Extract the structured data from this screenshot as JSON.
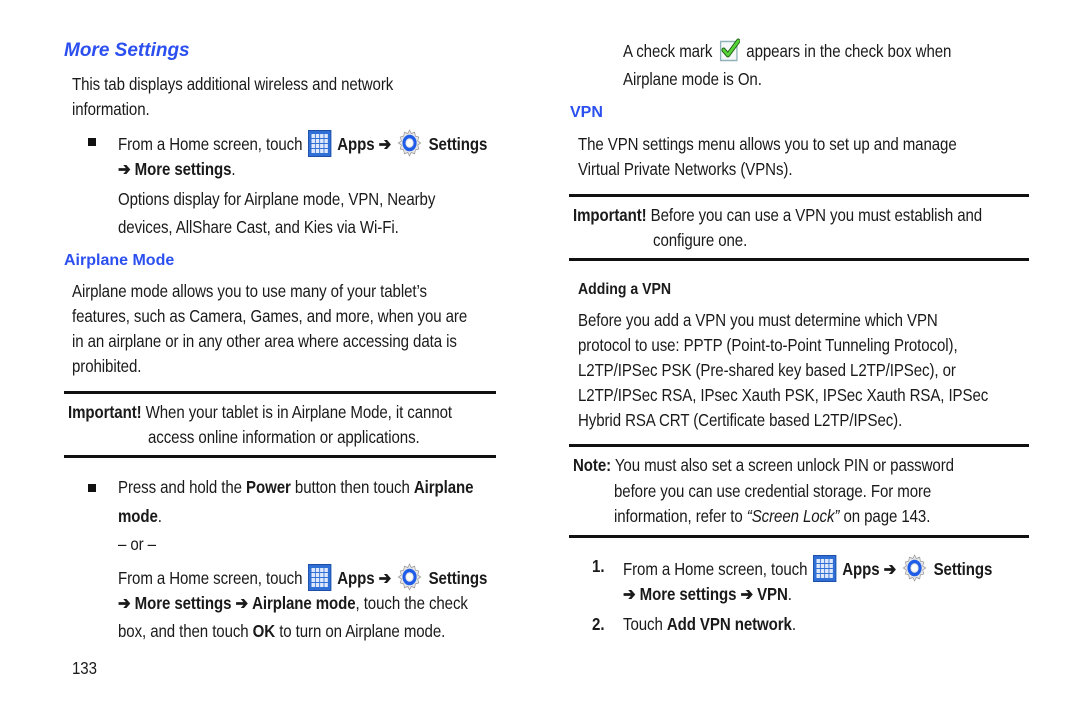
{
  "page_number": "133",
  "left": {
    "title": "More Settings",
    "intro": [
      "This tab displays additional wireless and network",
      "information."
    ],
    "step1": {
      "prefix": "From a Home screen, touch",
      "apps": "Apps",
      "arrow": "➔",
      "settings": "Settings",
      "line2_arrow": "➔",
      "line2_bold": "More settings",
      "line2_end": "."
    },
    "options_text": [
      "Options display for Airplane mode, VPN, Nearby",
      "devices, AllShare Cast, and Kies via Wi-Fi."
    ],
    "airplane_heading": "Airplane Mode",
    "airplane_body": [
      "Airplane mode allows you to use many of your tablet’s",
      "features, such as Camera, Games, and more, when you are",
      "in an airplane or in any other area where accessing data is",
      "prohibited."
    ],
    "important": {
      "label": "Important!",
      "line1": "When your tablet is in Airplane Mode, it cannot",
      "line2": "access online information or applications."
    },
    "step2": {
      "l1_a": "Press and hold the",
      "l1_b": "Power",
      "l1_c": "button then touch",
      "l1_d": "Airplane",
      "l2_bold": "mode",
      "l2_end": ".",
      "or": "– or –",
      "l3_prefix": "From a Home screen, touch",
      "l3_apps": "Apps",
      "l3_arrow": "➔",
      "l3_settings": "Settings",
      "l4_arrow1": "➔",
      "l4_more": "More settings",
      "l4_arrow2": "➔",
      "l4_airplane": "Airplane mode",
      "l4_end": ", touch the check",
      "l5_a": "box, and then touch",
      "l5_ok": "OK",
      "l5_end": "to turn on Airplane mode."
    }
  },
  "right": {
    "check_line1_a": "A check mark",
    "check_line1_b": "appears in the check box when",
    "check_line2": "Airplane mode is On.",
    "vpn_heading": "VPN",
    "vpn_body": [
      "The VPN settings menu allows you to set up and manage",
      "Virtual Private Networks (VPNs)."
    ],
    "important": {
      "label": "Important!",
      "line1": "Before you can use a VPN you must establish and",
      "line2": "configure one."
    },
    "adding_heading": "Adding a VPN",
    "adding_body": [
      "Before you add a VPN you must determine which VPN",
      "protocol to use: PPTP (Point-to-Point Tunneling Protocol),",
      "L2TP/IPSec PSK (Pre-shared key based L2TP/IPSec), or",
      "L2TP/IPSec RSA, IPsec Xauth PSK, IPSec Xauth RSA, IPSec",
      "Hybrid RSA CRT (Certificate based L2TP/IPSec)."
    ],
    "note": {
      "label": "Note:",
      "line1": "You must also set a screen unlock PIN or password",
      "line2": "before you can use credential storage. For more",
      "line3_a": "information, refer to",
      "line3_link": "“Screen Lock”",
      "line3_b": "on page 143."
    },
    "steps": [
      {
        "num": "1.",
        "prefix": "From a Home screen, touch",
        "apps": "Apps",
        "arrow": "➔",
        "settings": "Settings",
        "l2_arrow1": "➔",
        "l2_more": "More settings",
        "l2_arrow2": "➔",
        "l2_vpn": "VPN",
        "l2_end": "."
      },
      {
        "num": "2.",
        "a": "Touch",
        "bold": "Add VPN network",
        "end": "."
      }
    ]
  },
  "colors": {
    "heading": "#2c4ff0",
    "text": "#1a1a1a",
    "rule": "#111111"
  }
}
